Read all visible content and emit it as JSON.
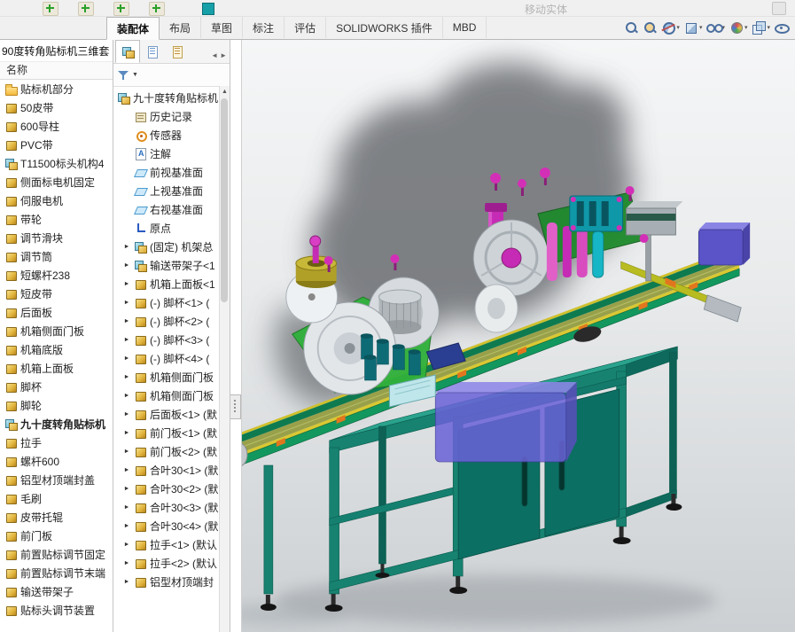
{
  "window": {
    "doc_title": "90度转角贴标机三维套"
  },
  "top_strip": {
    "disabled_label": "移动实体"
  },
  "command_tabs": [
    {
      "label": "装配体",
      "active": true
    },
    {
      "label": "布局"
    },
    {
      "label": "草图"
    },
    {
      "label": "标注"
    },
    {
      "label": "评估"
    },
    {
      "label": "SOLIDWORKS 插件"
    },
    {
      "label": "MBD"
    }
  ],
  "view_toolbar": [
    {
      "icon": "zoom-fit-icon"
    },
    {
      "icon": "zoom-area-icon"
    },
    {
      "icon": "section-view-icon",
      "caret": true
    },
    {
      "icon": "display-style-icon",
      "caret": true
    },
    {
      "icon": "hide-show-icon",
      "caret": true
    },
    {
      "icon": "appearance-icon",
      "caret": true
    },
    {
      "icon": "view-orientation-icon",
      "caret": true
    },
    {
      "icon": "visibility-icon"
    }
  ],
  "file_panel": {
    "header": "名称",
    "items": [
      {
        "label": "贴标机部分",
        "icon": "folder"
      },
      {
        "label": "50皮带",
        "icon": "part"
      },
      {
        "label": "600导柱",
        "icon": "part"
      },
      {
        "label": "PVC带",
        "icon": "part"
      },
      {
        "label": "T11500标头机构4",
        "icon": "asm"
      },
      {
        "label": "侧面标电机固定",
        "icon": "part"
      },
      {
        "label": "伺服电机",
        "icon": "part"
      },
      {
        "label": "带轮",
        "icon": "part"
      },
      {
        "label": "调节滑块",
        "icon": "part"
      },
      {
        "label": "调节筒",
        "icon": "part"
      },
      {
        "label": "短螺杆238",
        "icon": "part"
      },
      {
        "label": "短皮带",
        "icon": "part"
      },
      {
        "label": "后面板",
        "icon": "part"
      },
      {
        "label": "机箱侧面门板",
        "icon": "part"
      },
      {
        "label": "机箱底版",
        "icon": "part"
      },
      {
        "label": "机箱上面板",
        "icon": "part"
      },
      {
        "label": "脚杯",
        "icon": "part"
      },
      {
        "label": "脚轮",
        "icon": "part"
      },
      {
        "label": "九十度转角贴标机",
        "icon": "asm",
        "bold": true
      },
      {
        "label": "拉手",
        "icon": "part"
      },
      {
        "label": "螺杆600",
        "icon": "part"
      },
      {
        "label": "铝型材顶端封盖",
        "icon": "part"
      },
      {
        "label": "毛刷",
        "icon": "part"
      },
      {
        "label": "皮带托辊",
        "icon": "part"
      },
      {
        "label": "前门板",
        "icon": "part"
      },
      {
        "label": "前置贴标调节固定",
        "icon": "part"
      },
      {
        "label": "前置贴标调节末端",
        "icon": "part"
      },
      {
        "label": "输送带架子",
        "icon": "part"
      },
      {
        "label": "贴标头调节装置",
        "icon": "part"
      }
    ]
  },
  "feature_tree": {
    "root": {
      "label": "九十度转角贴标机",
      "icon": "asm"
    },
    "items": [
      {
        "label": "历史记录",
        "icon": "history",
        "arrow": false
      },
      {
        "label": "传感器",
        "icon": "sensor",
        "arrow": false
      },
      {
        "label": "注解",
        "icon": "annotation",
        "arrow": false
      },
      {
        "label": "前视基准面",
        "icon": "plane",
        "arrow": false
      },
      {
        "label": "上视基准面",
        "icon": "plane",
        "arrow": false
      },
      {
        "label": "右视基准面",
        "icon": "plane",
        "arrow": false
      },
      {
        "label": "原点",
        "icon": "origin",
        "arrow": false
      },
      {
        "label": "(固定) 机架总",
        "icon": "asm"
      },
      {
        "label": "输送带架子<1",
        "icon": "asm"
      },
      {
        "label": "机箱上面板<1",
        "icon": "part"
      },
      {
        "label": "(-) 脚杯<1> (",
        "icon": "part"
      },
      {
        "label": "(-) 脚杯<2> (",
        "icon": "part"
      },
      {
        "label": "(-) 脚杯<3> (",
        "icon": "part"
      },
      {
        "label": "(-) 脚杯<4> (",
        "icon": "part"
      },
      {
        "label": "机箱侧面门板",
        "icon": "part"
      },
      {
        "label": "机箱侧面门板",
        "icon": "part"
      },
      {
        "label": "后面板<1> (默",
        "icon": "part"
      },
      {
        "label": "前门板<1> (默",
        "icon": "part"
      },
      {
        "label": "前门板<2> (默",
        "icon": "part"
      },
      {
        "label": "合叶30<1> (默",
        "icon": "part"
      },
      {
        "label": "合叶30<2> (默",
        "icon": "part"
      },
      {
        "label": "合叶30<3> (默",
        "icon": "part"
      },
      {
        "label": "合叶30<4> (默",
        "icon": "part"
      },
      {
        "label": "拉手<1> (默认",
        "icon": "part"
      },
      {
        "label": "拉手<2> (默认",
        "icon": "part"
      },
      {
        "label": "铝型材顶端封",
        "icon": "part"
      }
    ]
  }
}
